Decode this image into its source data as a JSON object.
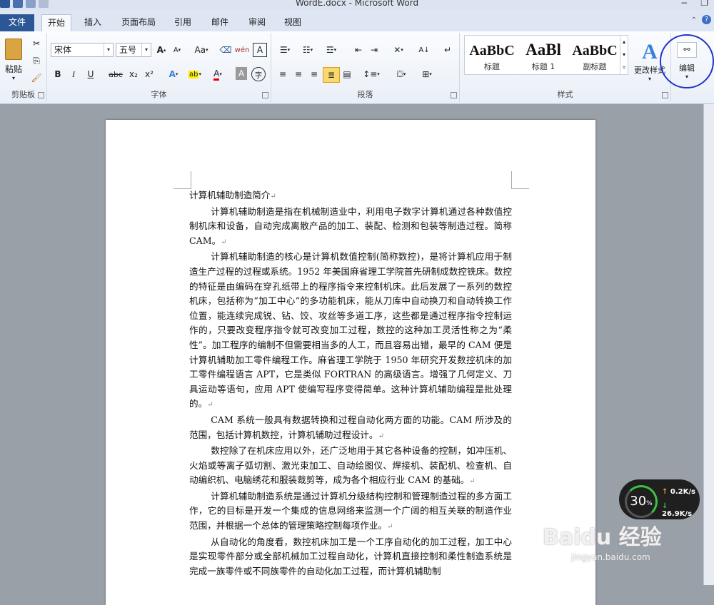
{
  "window": {
    "title": "WordE.docx - Microsoft Word",
    "min": "−",
    "restore": "❐",
    "help": "?"
  },
  "tabs": [
    "文件",
    "开始",
    "插入",
    "页面布局",
    "引用",
    "邮件",
    "审阅",
    "视图"
  ],
  "clipboard": {
    "paste": "粘贴",
    "label": "剪贴板"
  },
  "font": {
    "name": "宋体",
    "size": "五号",
    "label": "字体",
    "grow": "A",
    "shrink": "A",
    "aa": "Aa",
    "bold": "B",
    "italic": "I",
    "underline": "U",
    "strike": "abc",
    "sub": "x₂",
    "sup": "x²",
    "color_letter": "A"
  },
  "paragraph": {
    "label": "段落"
  },
  "styles": {
    "label": "样式",
    "items": [
      {
        "preview": "AaBbC",
        "name": "标题"
      },
      {
        "preview": "AaBl",
        "name": "标题 1"
      },
      {
        "preview": "AaBbC",
        "name": "副标题"
      }
    ],
    "change": "更改样式"
  },
  "editing": {
    "label": "编辑"
  },
  "document": {
    "title": "计算机辅助制造简介",
    "paragraphs": [
      "计算机辅助制造是指在机械制造业中，利用电子数字计算机通过各种数值控制机床和设备，自动完成离散产品的加工、装配、检测和包装等制造过程。简称 CAM。",
      "计算机辅助制造的核心是计算机数值控制(简称数控)，是将计算机应用于制造生产过程的过程或系统。1952 年美国麻省理工学院首先研制成数控铣床。数控的特征是由编码在穿孔纸带上的程序指令来控制机床。此后发展了一系列的数控机床，包括称为“加工中心”的多功能机床，能从刀库中自动换刀和自动转换工作位置，能连续完成锐、钻、饺、攻丝等多道工序，这些都是通过程序指令控制运作的，只要改变程序指令就可改变加工过程，数控的这种加工灵活性称之为“柔性”。加工程序的编制不但需要相当多的人工，而且容易出错，最早的 CAM 便是计算机辅助加工零件编程工作。麻省理工学院于 1950 年研究开发数控机床的加工零件编程语言 APT，它是类似 FORTRAN 的高级语言。增强了几何定义、刀具运动等语句，应用 APT 使编写程序变得简单。这种计算机辅助编程是批处理的。",
      "CAM 系统一般具有数据转换和过程自动化两方面的功能。CAM 所涉及的范围，包括计算机数控，计算机辅助过程设计。",
      "数控除了在机床应用以外，还广泛地用于其它各种设备的控制，如冲压机、火焰或等离子弧切割、激光束加工、自动绘图仪、焊接机、装配机、检查机、自动编织机、电脑绣花和服装裁剪等，成为各个相应行业 CAM 的基础。",
      "计算机辅助制造系统是通过计算机分级结构控制和管理制造过程的多方面工作，它的目标是开发一个集成的信息网络来监测一个广阔的相互关联的制造作业范围，并根据一个总体的管理策略控制每项作业。",
      "从自动化的角度看，数控机床加工是一个工序自动化的加工过程，加工中心是实现零件部分或全部机械加工过程自动化，计算机直接控制和柔性制造系统是完成一族零件或不同族零件的自动化加工过程，而计算机辅助制"
    ],
    "mark": "↵"
  },
  "netmon": {
    "percent": "30",
    "pct_sign": "%",
    "up": "0.2K/s",
    "down": "26.9K/s"
  },
  "watermark": {
    "brand": "Baidu 经验",
    "url": "jingyan.baidu.com"
  }
}
